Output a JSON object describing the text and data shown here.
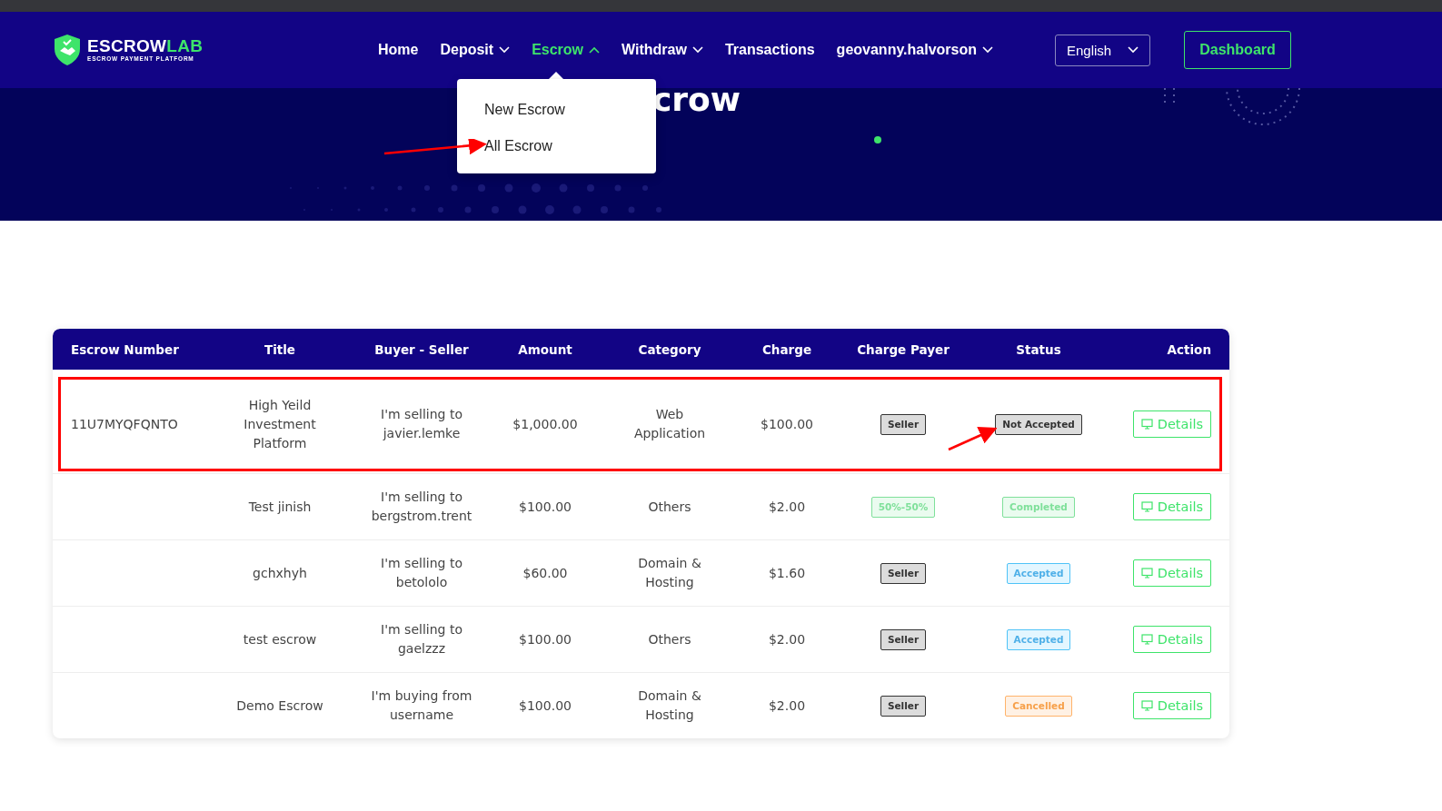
{
  "logo": {
    "name_main": "ESCROW",
    "name_accent": "LAB",
    "tagline": "ESCROW PAYMENT PLATFORM"
  },
  "nav": [
    {
      "label": "Home",
      "dropdown": false,
      "selected": false
    },
    {
      "label": "Deposit",
      "dropdown": true,
      "selected": false
    },
    {
      "label": "Escrow",
      "dropdown": true,
      "selected": true
    },
    {
      "label": "Withdraw",
      "dropdown": true,
      "selected": false
    },
    {
      "label": "Transactions",
      "dropdown": false,
      "selected": false
    },
    {
      "label": "geovanny.halvorson",
      "dropdown": true,
      "selected": false
    }
  ],
  "language": {
    "value": "English"
  },
  "dashboard_button": "Dashboard",
  "dropdown_menu": [
    {
      "label": "New Escrow",
      "pointed": false
    },
    {
      "label": "All Escrow",
      "pointed": true
    }
  ],
  "hero": {
    "title": "crow"
  },
  "table": {
    "columns": [
      "Escrow Number",
      "Title",
      "Buyer - Seller",
      "Amount",
      "Category",
      "Charge",
      "Charge Payer",
      "Status",
      "Action"
    ],
    "rows": [
      {
        "escrow_number": "11U7MYQFQNTO",
        "title": "High Yeild Investment Platform",
        "buyer_seller": "I'm selling to javier.lemke",
        "amount": "$1,000.00",
        "category": "Web Application",
        "charge": "$100.00",
        "charge_payer": {
          "label": "Seller",
          "kind": "seller"
        },
        "status": {
          "label": "Not Accepted",
          "kind": "not_accepted",
          "pointed": true
        },
        "action": "Details",
        "highlighted": true
      },
      {
        "title": "Test jinish",
        "buyer_seller": "I'm selling to bergstrom.trent",
        "amount": "$100.00",
        "category": "Others",
        "charge": "$2.00",
        "charge_payer": {
          "label": "50%-50%",
          "kind": "split"
        },
        "status": {
          "label": "Completed",
          "kind": "completed",
          "pointed": false
        },
        "action": "Details",
        "highlighted": false
      },
      {
        "title": "gchxhyh",
        "buyer_seller": "I'm selling to betololo",
        "amount": "$60.00",
        "category": "Domain & Hosting",
        "charge": "$1.60",
        "charge_payer": {
          "label": "Seller",
          "kind": "seller"
        },
        "status": {
          "label": "Accepted",
          "kind": "accepted",
          "pointed": false
        },
        "action": "Details",
        "highlighted": false
      },
      {
        "title": "test escrow",
        "buyer_seller": "I'm selling to gaelzzz",
        "amount": "$100.00",
        "category": "Others",
        "charge": "$2.00",
        "charge_payer": {
          "label": "Seller",
          "kind": "seller"
        },
        "status": {
          "label": "Accepted",
          "kind": "accepted",
          "pointed": false
        },
        "action": "Details",
        "highlighted": false
      },
      {
        "title": "Demo Escrow",
        "buyer_seller": "I'm buying from username",
        "amount": "$100.00",
        "category": "Domain & Hosting",
        "charge": "$2.00",
        "charge_payer": {
          "label": "Seller",
          "kind": "seller"
        },
        "status": {
          "label": "Cancelled",
          "kind": "cancelled",
          "pointed": false
        },
        "action": "Details",
        "highlighted": false
      }
    ]
  }
}
